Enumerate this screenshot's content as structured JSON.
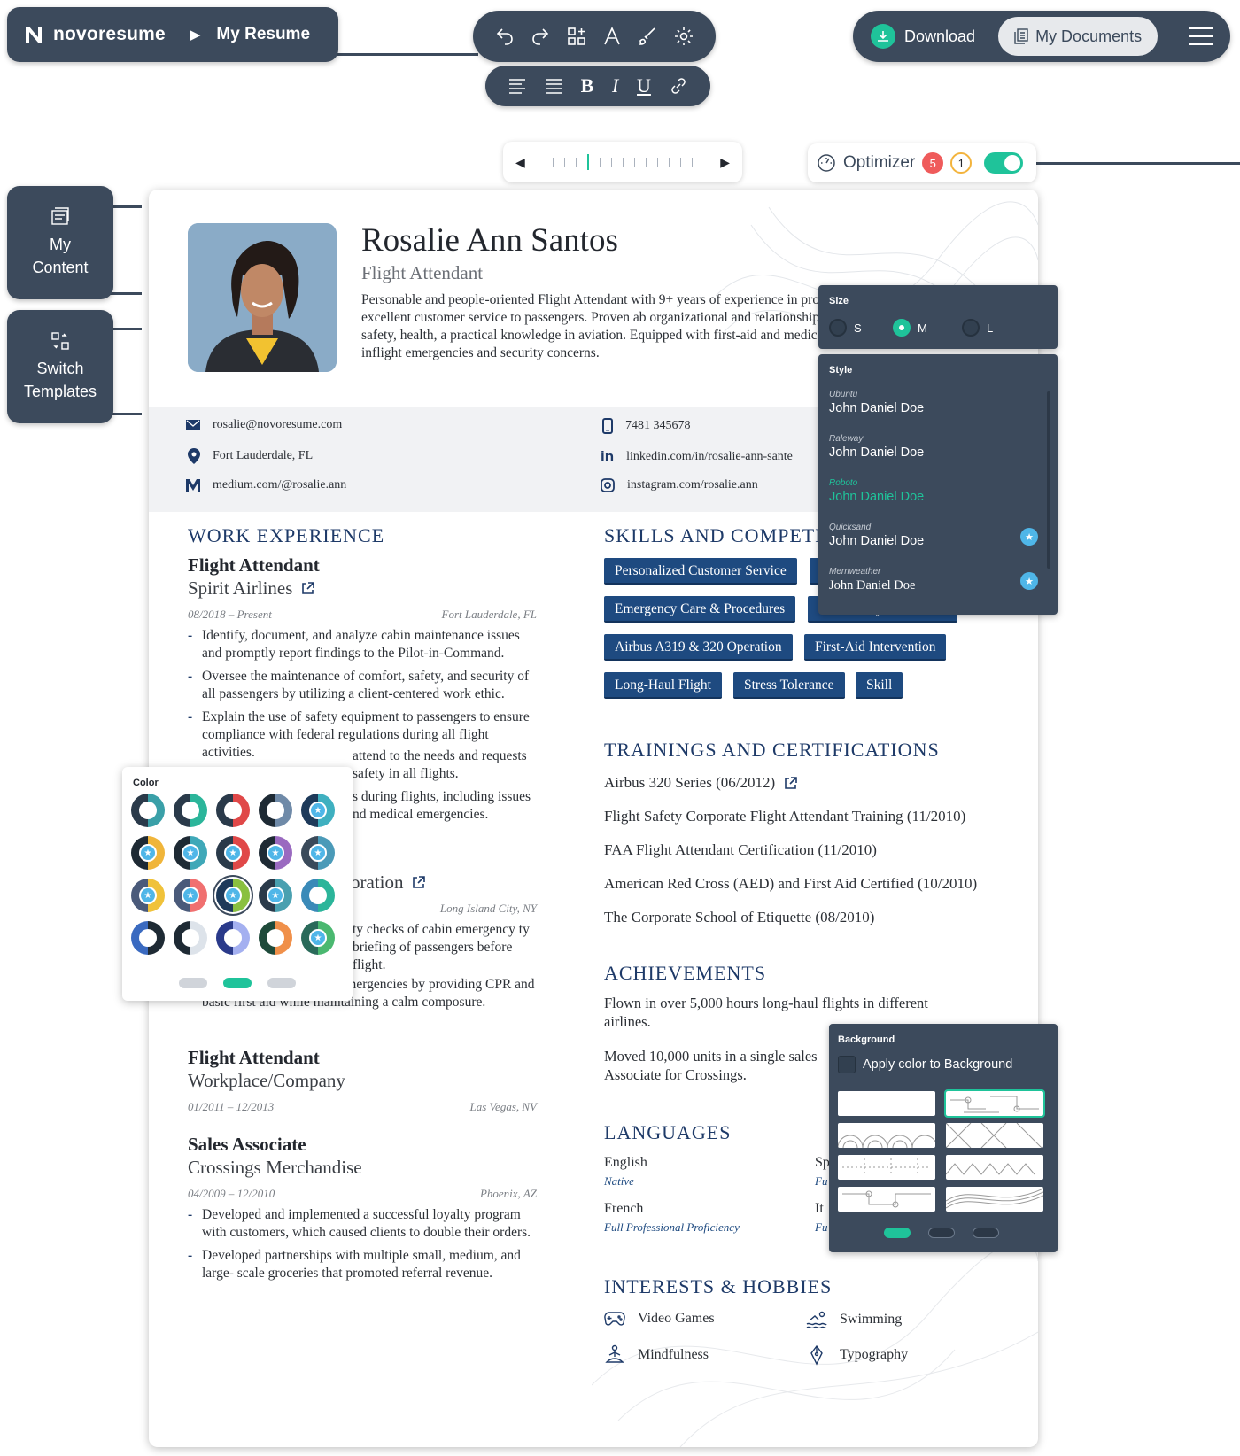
{
  "app": {
    "brand": "novoresume",
    "breadcrumb": "My Resume"
  },
  "toolbar": {
    "download_label": "Download",
    "documents_label": "My Documents"
  },
  "optimizer": {
    "label": "Optimizer",
    "errors": "5",
    "warnings": "1",
    "enabled": true
  },
  "zoom": {
    "level_index": 3,
    "tick_count": 13
  },
  "side": {
    "my_content_line1": "My",
    "my_content_line2": "Content",
    "switch_line1": "Switch",
    "switch_line2": "Templates"
  },
  "resume": {
    "name": "Rosalie Ann Santos",
    "title": "Flight Attendant",
    "summary": "Personable and people-oriented Flight Attendant with 9+ years of experience in procedures while providing excellent customer service to passengers. Proven ab organizational and relationship-building capabilities. Adept at safety, health, a practical knowledge in aviation. Equipped with first-aid and medical emergenc skills to respond to inflight emergencies and security concerns.",
    "contacts": {
      "email": "rosalie@novoresume.com",
      "location": "Fort Lauderdale, FL",
      "medium": "medium.com/@rosalie.ann",
      "phone": "7481 345678",
      "linkedin": "linkedin.com/in/rosalie-ann-sante",
      "instagram": "instagram.com/rosalie.ann"
    },
    "work_heading": "WORK EXPERIENCE",
    "jobs": [
      {
        "title": "Flight Attendant",
        "company": "Spirit Airlines",
        "dates": "08/2018 – Present",
        "location": "Fort Lauderdale, FL",
        "bullets": [
          "Identify, document, and analyze cabin maintenance issues and promptly report findings to the Pilot-in-Command.",
          "Oversee the maintenance of comfort, safety, and security of all passengers by utilizing a client-centered work ethic.",
          "Explain the use of safety equipment to passengers to ensure compliance with federal regulations during all flight activities.",
          "attend to the needs and requests safety in all flights.",
          "s during flights, including issues nd medical emergencies."
        ]
      },
      {
        "title": "",
        "company": "oration",
        "dates": "",
        "location": "Long Island City, NY",
        "bullets": [
          "ty checks of cabin emergency ty briefing of passengers before flight.",
          "Assisted during onboard emergencies by providing CPR and basic first aid while maintaining a calm composure."
        ]
      },
      {
        "title": "Flight Attendant",
        "company": "Workplace/Company",
        "dates": "01/2011 – 12/2013",
        "location": "Las Vegas, NV",
        "bullets": []
      },
      {
        "title": "Sales Associate",
        "company": "Crossings Merchandise",
        "dates": "04/2009 – 12/2010",
        "location": "Phoenix, AZ",
        "bullets": [
          "Developed and implemented a successful loyalty program with customers, which caused clients to double their orders.",
          "Developed partnerships with multiple small, medium, and large- scale groceries that promoted referral revenue."
        ]
      }
    ],
    "skills_heading": "SKILLS AND COMPETE",
    "skills": [
      "Personalized Customer Service",
      "Emergency Care & Procedures",
      "FAA Safety Procedures",
      "Airbus A319 & 320 Operation",
      "First-Aid Intervention",
      "Long-Haul Flight",
      "Stress Tolerance",
      "Skill"
    ],
    "certs_heading": "TRAININGS AND CERTIFICATIONS",
    "certs": [
      "Airbus 320 Series (06/2012)",
      "Flight Safety Corporate Flight Attendant Training (11/2010)",
      "FAA Flight Attendant Certification (11/2010)",
      "American Red Cross (AED) and First Aid Certified (10/2010)",
      "The Corporate School of Etiquette (08/2010)"
    ],
    "achievements_heading": "ACHIEVEMENTS",
    "achievements": [
      "Flown in over 5,000 hours long-haul flights in different airlines.",
      "Moved 10,000 units in a single sales Associate for Crossings."
    ],
    "languages_heading": "LANGUAGES",
    "languages": [
      {
        "name": "English",
        "level": "Native"
      },
      {
        "name": "French",
        "level": "Full Professional Proficiency"
      },
      {
        "name": "Sp",
        "level": "Fu"
      },
      {
        "name": "It",
        "level": "Fu"
      }
    ],
    "hobbies_heading": "INTERESTS & HOBBIES",
    "hobbies": [
      "Video Games",
      "Swimming",
      "Mindfulness",
      "Typography"
    ]
  },
  "size_panel": {
    "heading": "Size",
    "options": [
      "S",
      "M",
      "L"
    ],
    "selected": "M"
  },
  "style_panel": {
    "heading": "Style",
    "fonts": [
      {
        "name": "Ubuntu",
        "sample": "John Daniel Doe"
      },
      {
        "name": "Raleway",
        "sample": "John Daniel Doe"
      },
      {
        "name": "Roboto",
        "sample": "John Daniel Doe"
      },
      {
        "name": "Quicksand",
        "sample": "John Daniel Doe"
      },
      {
        "name": "Merriweather",
        "sample": "John Daniel Doe"
      }
    ],
    "selected": "Roboto"
  },
  "color_panel": {
    "heading": "Color",
    "page": 2,
    "pages": 3
  },
  "background_panel": {
    "heading": "Background",
    "checkbox_label": "Apply color to Background",
    "page": 1,
    "pages": 3
  },
  "colors": {
    "dark_ui": "#3c4a5c",
    "accent": "#1fc39a",
    "navy": "#1e3a68",
    "skill_bg": "#1e4a80"
  }
}
